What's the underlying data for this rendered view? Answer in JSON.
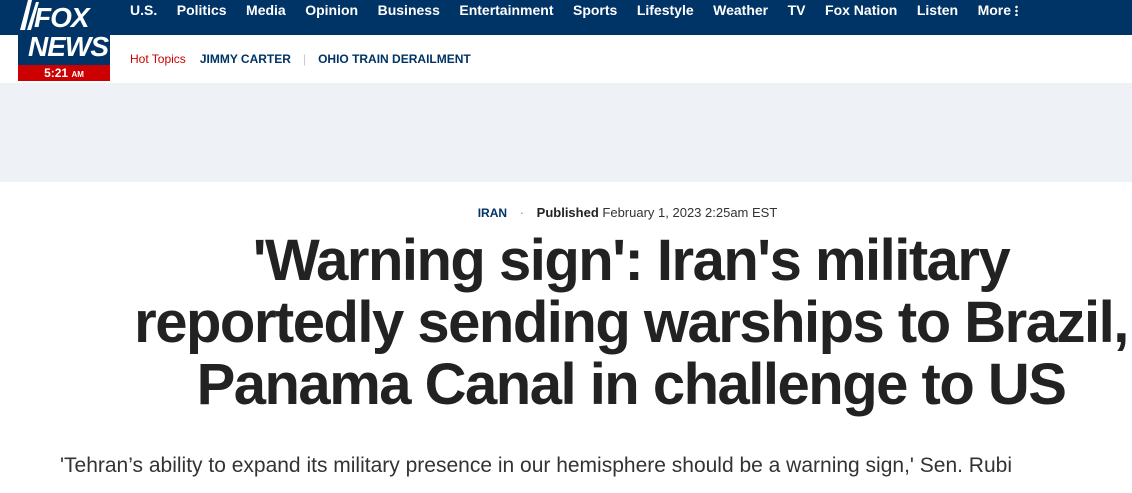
{
  "logo": {
    "fox": "FOX",
    "news": "NEWS",
    "time": "5:21",
    "ampm": "AM"
  },
  "nav": {
    "items": [
      "U.S.",
      "Politics",
      "Media",
      "Opinion",
      "Business",
      "Entertainment",
      "Sports",
      "Lifestyle",
      "Weather",
      "TV",
      "Fox Nation",
      "Listen"
    ],
    "more_label": "More"
  },
  "subnav": {
    "hot_label": "Hot Topics",
    "topics": [
      "JIMMY CARTER",
      "OHIO TRAIN DERAILMENT"
    ]
  },
  "article": {
    "category": "IRAN",
    "published_label": "Published",
    "published_date": "February 1, 2023 2:25am EST",
    "headline": "'Warning sign': Iran's military reportedly sending warships to Brazil, Panama Canal in challenge to US",
    "subhead": "'Tehran’s ability to expand its military presence in our hemisphere should be a warning sign,' Sen. Rubi"
  }
}
